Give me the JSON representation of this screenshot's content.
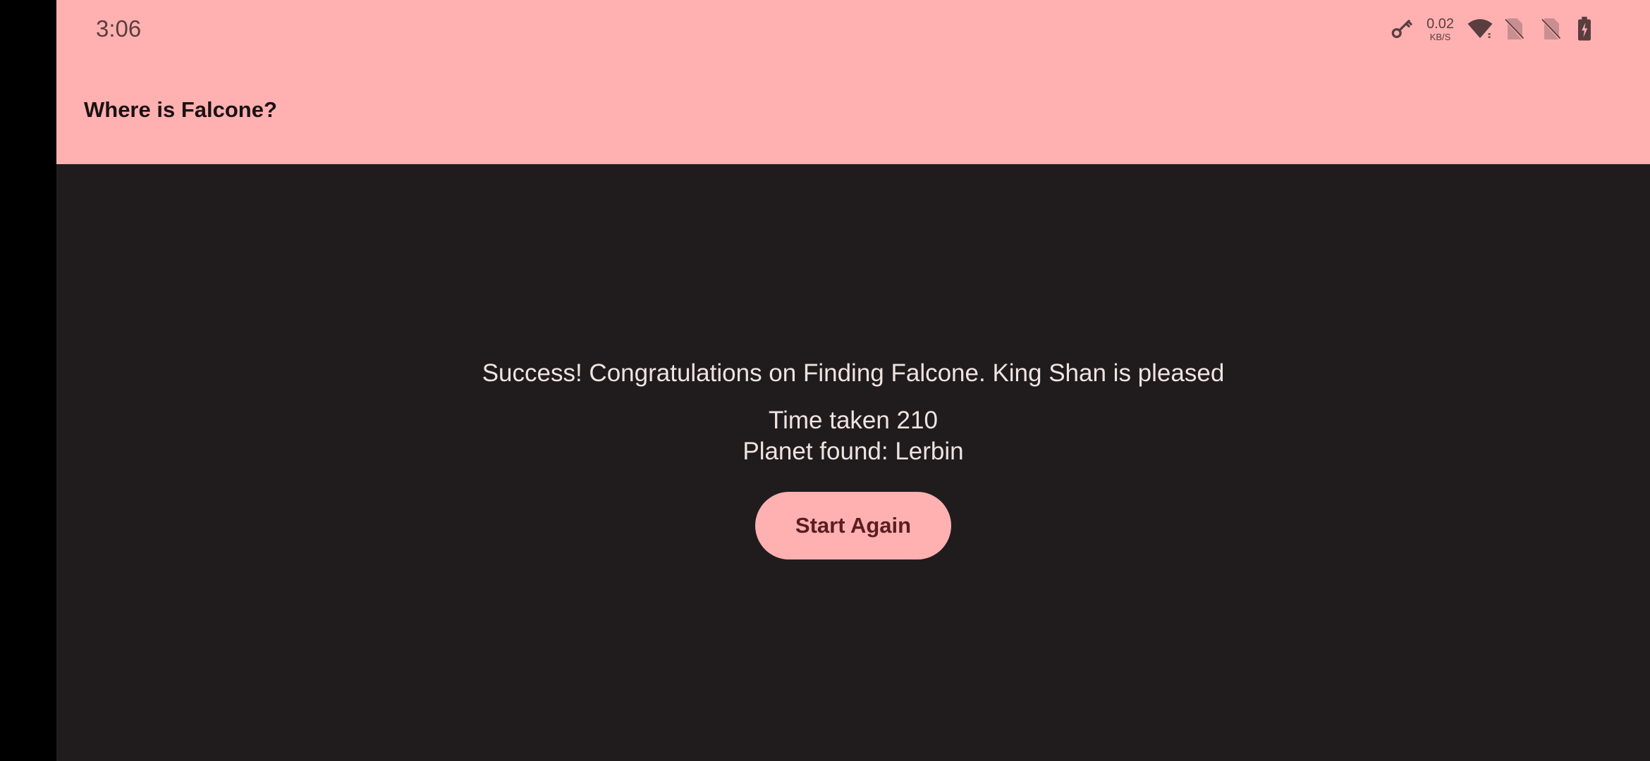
{
  "status_bar": {
    "time": "3:06",
    "net_speed_value": "0.02",
    "net_speed_unit": "KB/S",
    "icons": [
      "vpn-key-icon",
      "wifi-icon",
      "no-sim-icon",
      "no-sim-icon",
      "battery-charging-icon"
    ]
  },
  "app_bar": {
    "title": "Where is Falcone?"
  },
  "result": {
    "message": "Success! Congratulations on Finding Falcone. King Shan is pleased",
    "time_taken": "Time taken 210",
    "planet_found": "Planet found: Lerbin"
  },
  "actions": {
    "start_again_label": "Start Again"
  },
  "colors": {
    "app_bar": "#ffb1b1",
    "background": "#201c1d",
    "button": "#ffb1b1",
    "button_text": "#5a1d22",
    "body_text": "#efe3e3"
  }
}
